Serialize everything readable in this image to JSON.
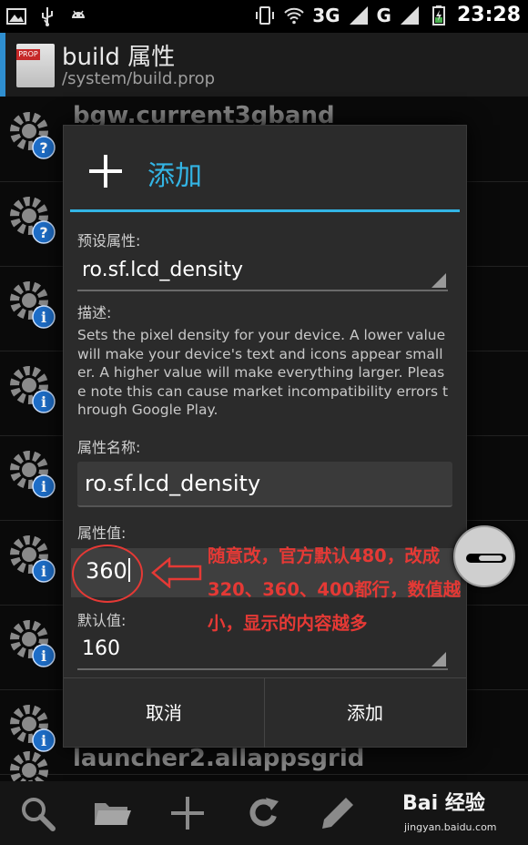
{
  "status_bar": {
    "network_3g": "3G",
    "network_g": "G",
    "time": "23:28"
  },
  "header": {
    "title": "build 属性",
    "subtitle": "/system/build.prop",
    "file_icon_label": "PROP"
  },
  "background_list": {
    "items": [
      {
        "title": "bgw.current3gband",
        "icon": "gear-help-icon"
      },
      {
        "title": "",
        "icon": "gear-help-icon"
      },
      {
        "title": "",
        "icon": "gear-help-icon"
      },
      {
        "title": "",
        "icon": "gear-info-icon"
      },
      {
        "title": "",
        "icon": "gear-info-icon"
      },
      {
        "title": "",
        "icon": "gear-info-icon"
      },
      {
        "title": "",
        "icon": "gear-info-icon"
      },
      {
        "title": "",
        "icon": "gear-info-icon"
      },
      {
        "title": "launcher2.allappsgrid",
        "icon": "gear-help-icon"
      }
    ]
  },
  "dialog": {
    "title": "添加",
    "preset_label": "预设属性:",
    "preset_value": "ro.sf.lcd_density",
    "desc_label": "描述:",
    "description": "Sets the pixel density for your device. A lower value will make your device's text and icons appear smaller. A higher value will make everything larger. Please note this can cause market incompatibility errors through Google Play.",
    "name_label": "属性名称:",
    "name_value": "ro.sf.lcd_density",
    "value_label": "属性值:",
    "value_value": "360",
    "default_label": "默认值:",
    "default_value": "160",
    "cancel_label": "取消",
    "add_label": "添加"
  },
  "annotation": {
    "text": "随意改，官方默认480，改成320、360、400都行，数值越小，显示的内容越多",
    "color": "#e53935"
  },
  "watermark": {
    "logo": "Bai 经验",
    "url": "jingyan.baidu.com"
  },
  "colors": {
    "accent": "#33b5e5",
    "header_bar": "#2f8fd0",
    "annotation": "#e53935"
  }
}
